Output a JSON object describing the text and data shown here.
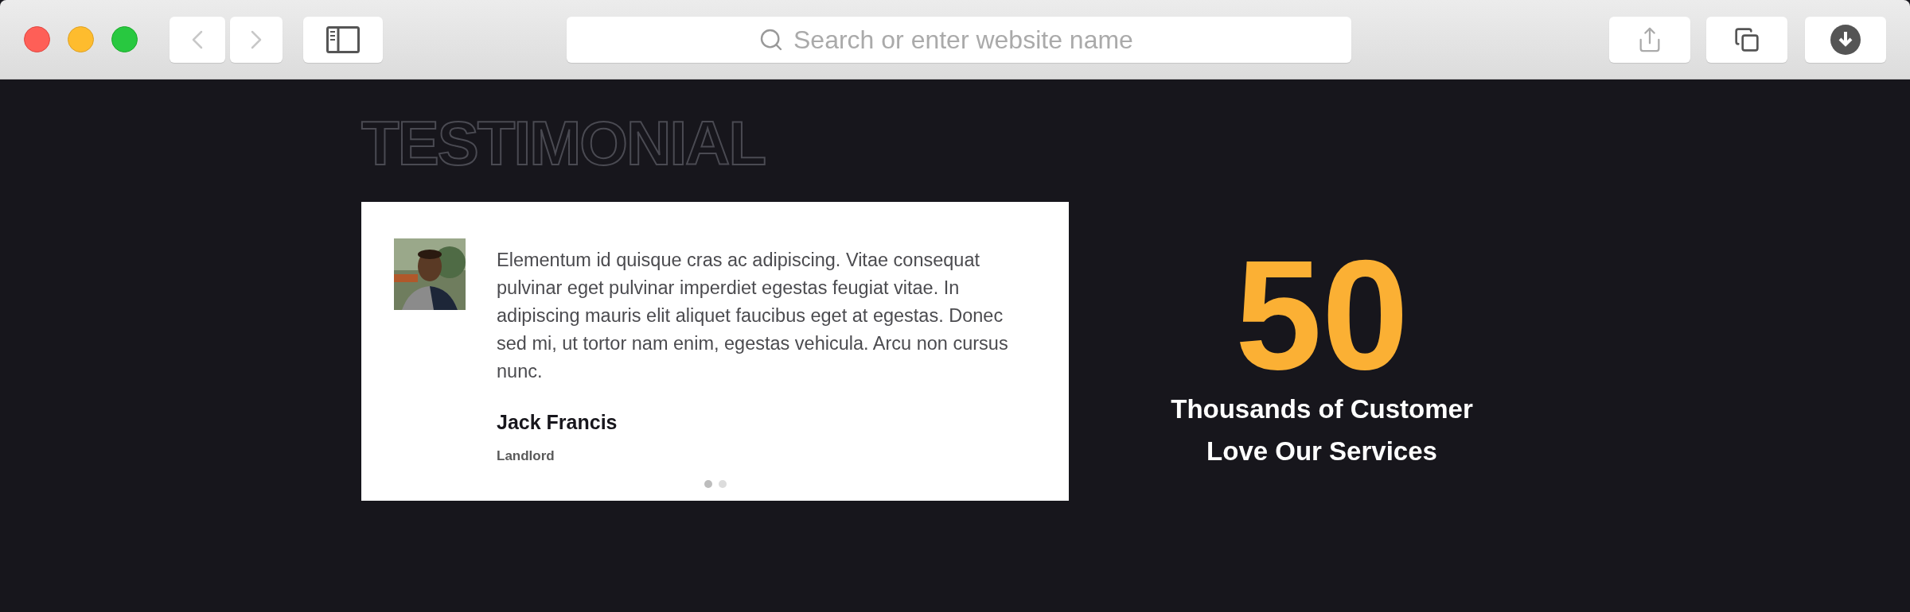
{
  "browser": {
    "address_bar": {
      "placeholder": "Search or enter website name"
    }
  },
  "section": {
    "heading": "TESTIMONIAL"
  },
  "testimonial": {
    "quote": "Elementum id quisque cras ac adipiscing. Vitae consequat pulvinar eget pulvinar imperdiet egestas feugiat vitae. In adipiscing mauris elit aliquet faucibus eget at egestas. Donec sed mi, ut tortor nam enim, egestas vehicula. Arcu non cursus nunc.",
    "name": "Jack Francis",
    "role": "Landlord",
    "dots": [
      {
        "selected": true
      },
      {
        "selected": false
      }
    ]
  },
  "stat": {
    "number": "50",
    "caption_lines": [
      "Thousands of Customer",
      "Love Our Services"
    ]
  }
}
